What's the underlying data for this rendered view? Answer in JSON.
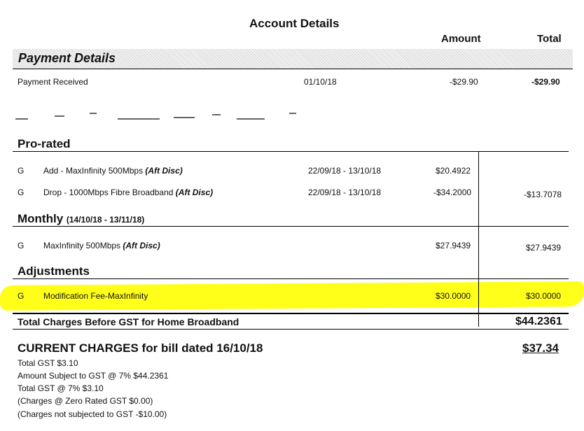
{
  "header": {
    "title": "Account Details",
    "amount_label": "Amount",
    "total_label": "Total"
  },
  "payment": {
    "section_title": "Payment Details",
    "row": {
      "label": "Payment Received",
      "date": "01/10/18",
      "amount": "-$29.90",
      "total": "-$29.90"
    }
  },
  "prorated": {
    "section_title": "Pro-rated",
    "rows": [
      {
        "code": "G",
        "desc": "Add - MaxInfinity 500Mbps ",
        "disc": "(Aft Disc)",
        "period": "22/09/18 - 13/10/18",
        "amount": "$20.4922"
      },
      {
        "code": "G",
        "desc": "Drop - 1000Mbps Fibre Broadband ",
        "disc": "(Aft Disc)",
        "period": "22/09/18 - 13/10/18",
        "amount": "-$34.2000"
      }
    ],
    "total": "-$13.7078"
  },
  "monthly": {
    "section_title": "Monthly ",
    "period": "(14/10/18 - 13/11/18)",
    "row": {
      "code": "G",
      "desc": "MaxInfinity 500Mbps ",
      "disc": "(Aft Disc)",
      "amount": "$27.9439",
      "total": "$27.9439"
    }
  },
  "adjustments": {
    "section_title": "Adjustments",
    "row": {
      "code": "G",
      "desc": "Modification Fee-MaxInfinity",
      "amount": "$30.0000",
      "total": "$30.0000"
    }
  },
  "totals": {
    "before_gst_label": "Total Charges Before GST for Home Broadband",
    "before_gst_value": "$44.2361"
  },
  "current": {
    "label": "CURRENT CHARGES for bill dated 16/10/18",
    "amount": "$37.34",
    "lines": [
      "Total GST $3.10",
      "Amount Subject to GST @ 7% $44.2361",
      "Total  GST @ 7% $3.10",
      "(Charges @ Zero Rated GST $0.00)",
      "(Charges not subjected to GST -$10.00)"
    ]
  },
  "colors": {
    "highlight": "#ffff1a"
  }
}
